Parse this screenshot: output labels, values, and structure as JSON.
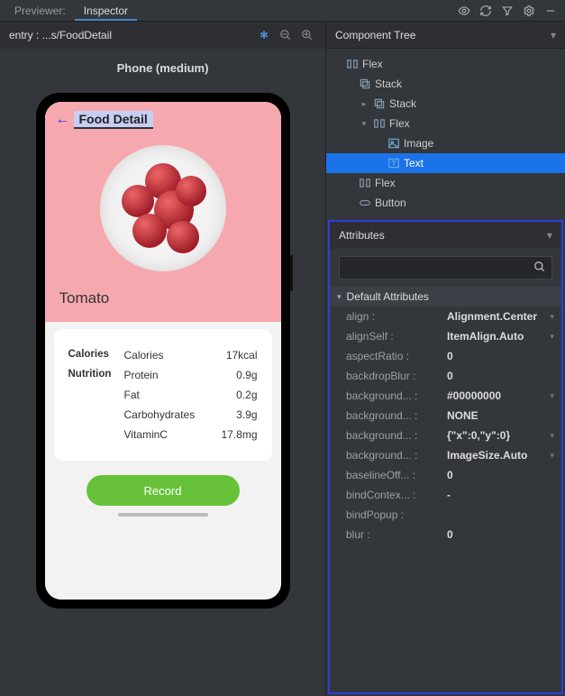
{
  "topbar": {
    "tabs": [
      "Previewer:",
      "Inspector"
    ],
    "active_index": 1
  },
  "preview": {
    "breadcrumb": "entry : ...s/FoodDetail",
    "device_label": "Phone (medium)"
  },
  "food": {
    "page_title": "Food Detail",
    "name": "Tomato",
    "rows": [
      {
        "group": "Calories",
        "label": "Calories",
        "value": "17kcal"
      },
      {
        "group": "Nutrition",
        "label": "Protein",
        "value": "0.9g"
      },
      {
        "group": "",
        "label": "Fat",
        "value": "0.2g"
      },
      {
        "group": "",
        "label": "Carbohydrates",
        "value": "3.9g"
      },
      {
        "group": "",
        "label": "VitaminC",
        "value": "17.8mg"
      }
    ],
    "record_label": "Record"
  },
  "tree": {
    "title": "Component Tree",
    "nodes": [
      {
        "indent": 0,
        "twist": "",
        "icon": "flex",
        "label": "Flex",
        "selected": false
      },
      {
        "indent": 1,
        "twist": "",
        "icon": "stack",
        "label": "Stack",
        "selected": false
      },
      {
        "indent": 2,
        "twist": "▸",
        "icon": "stack",
        "label": "Stack",
        "selected": false
      },
      {
        "indent": 2,
        "twist": "▾",
        "icon": "flex",
        "label": "Flex",
        "selected": false
      },
      {
        "indent": 3,
        "twist": "",
        "icon": "image",
        "label": "Image",
        "selected": false
      },
      {
        "indent": 3,
        "twist": "",
        "icon": "text",
        "label": "Text",
        "selected": true
      },
      {
        "indent": 1,
        "twist": "",
        "icon": "flex",
        "label": "Flex",
        "selected": false
      },
      {
        "indent": 1,
        "twist": "",
        "icon": "button",
        "label": "Button",
        "selected": false
      }
    ]
  },
  "attributes": {
    "title": "Attributes",
    "group_title": "Default Attributes",
    "search_placeholder": "",
    "rows": [
      {
        "name": "align :",
        "value": "Alignment.Center",
        "dropdown": true
      },
      {
        "name": "alignSelf :",
        "value": "ItemAlign.Auto",
        "dropdown": true
      },
      {
        "name": "aspectRatio :",
        "value": "0",
        "dropdown": false
      },
      {
        "name": "backdropBlur :",
        "value": "0",
        "dropdown": false
      },
      {
        "name": "background... :",
        "value": "#00000000",
        "dropdown": true
      },
      {
        "name": "background... :",
        "value": "NONE",
        "dropdown": false
      },
      {
        "name": "background... :",
        "value": "{\"x\":0,\"y\":0}",
        "dropdown": true
      },
      {
        "name": "background... :",
        "value": "ImageSize.Auto",
        "dropdown": true
      },
      {
        "name": "baselineOff... :",
        "value": "0",
        "dropdown": false
      },
      {
        "name": "bindContex... :",
        "value": "-",
        "dropdown": false
      },
      {
        "name": "bindPopup :",
        "value": "",
        "dropdown": false
      },
      {
        "name": "blur :",
        "value": "0",
        "dropdown": false
      }
    ]
  }
}
